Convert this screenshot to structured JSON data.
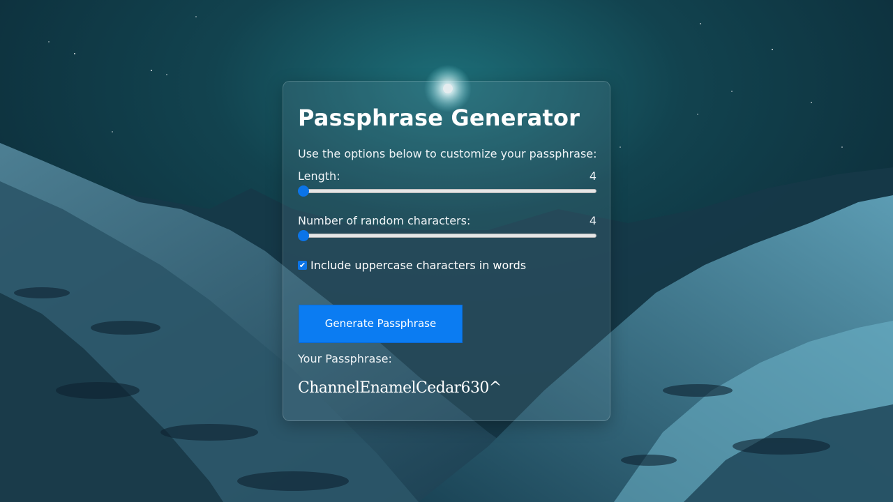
{
  "card": {
    "title": "Passphrase Generator",
    "intro": "Use the options below to customize your passphrase:"
  },
  "options": {
    "length": {
      "label": "Length:",
      "value": "4",
      "slider_fraction": 0.0
    },
    "random_chars": {
      "label": "Number of random characters:",
      "value": "4",
      "slider_fraction": 0.0
    },
    "uppercase": {
      "label": "Include uppercase characters in words",
      "checked": true
    }
  },
  "actions": {
    "generate_label": "Generate Passphrase"
  },
  "result": {
    "label": "Your Passphrase:",
    "value": "ChannelEnamelCedar630^"
  },
  "colors": {
    "accent": "#0b74e8",
    "button": "#0b7cf2"
  }
}
